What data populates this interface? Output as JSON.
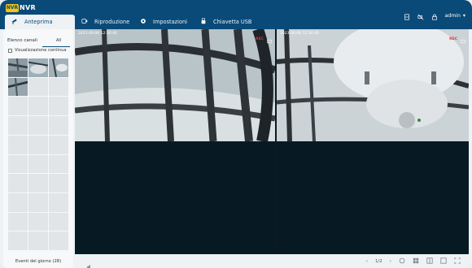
{
  "app": {
    "brand_logo": "NVR",
    "brand_name": "NVR"
  },
  "tabs": [
    {
      "label": "Anteprima",
      "icon": "camera-icon",
      "active": true
    },
    {
      "label": "Riproduzione",
      "icon": "playback-icon",
      "active": false
    },
    {
      "label": "Impostazioni",
      "icon": "gear-icon",
      "active": false
    },
    {
      "label": "Chiavetta USB",
      "icon": "usb-icon",
      "active": false
    }
  ],
  "top_right": {
    "icons": [
      "export-icon",
      "camera-off-icon",
      "lock-icon"
    ],
    "user": "admin"
  },
  "left_panel": {
    "channels_label": "Elenco canali",
    "channels_value": "All",
    "continuous_label": "Visualizzazione continua",
    "events_label": "Eventi del giorno (28)"
  },
  "videos": [
    {
      "timestamp": "2023-06-06 12:30:40",
      "rec": "REC"
    },
    {
      "timestamp": "2023-06-06 12:30:40",
      "rec": "REC"
    }
  ],
  "bottom_bar": {
    "page": "1/2"
  },
  "colors": {
    "topbar": "#0a4a78",
    "accent": "#f2c21a",
    "rec": "#e03131"
  }
}
